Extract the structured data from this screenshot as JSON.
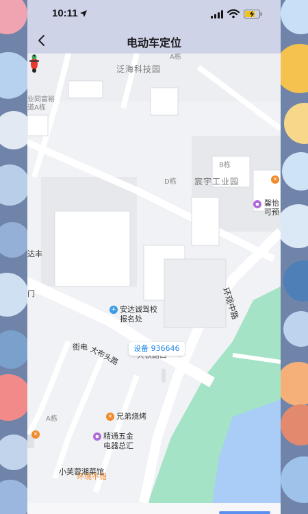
{
  "status_bar": {
    "time": "10:11",
    "icons": [
      "location-arrow-icon",
      "cellular-signal-icon",
      "wifi-icon",
      "battery-charging-icon"
    ]
  },
  "header": {
    "title": "电动车定位",
    "back_icon": "chevron-left-icon"
  },
  "map": {
    "areas": {
      "fanhai": "泛海科技园",
      "chenyu": "宸宇工业园"
    },
    "buildings": {
      "a_top": "A栋",
      "b": "B栋",
      "d": "D栋",
      "a_bottom": "A栋"
    },
    "edge_labels": {
      "tonggaoyu_line1": "业同富裕",
      "tonggaoyu_line2": "道A栋",
      "dafeng": "达丰",
      "men": "门",
      "xinyi_line1": "馨怡",
      "xinyi_line2": "可预"
    },
    "roads": {
      "dabutou": "大布头路",
      "huanguanzhong": "环观中路",
      "jiedian": "街电",
      "partial": "大铁路口"
    },
    "pois": {
      "driving_school_line1": "安达诚驾校",
      "driving_school_line2": "报名处",
      "bbq": "兄弟烧烤",
      "hardware_line1": "精通五金",
      "hardware_line2": "电器总汇",
      "restaurant_line1": "小芙蓉湘菜馆",
      "restaurant_line2": "环境不错"
    },
    "device_label": "设备 936646",
    "colors": {
      "water": "#a9cdf6",
      "park": "#a5e3c6",
      "road": "#ffffff",
      "building": "#ffffff",
      "block": "#e9ebef",
      "badge_text": "#1f86e6"
    }
  }
}
